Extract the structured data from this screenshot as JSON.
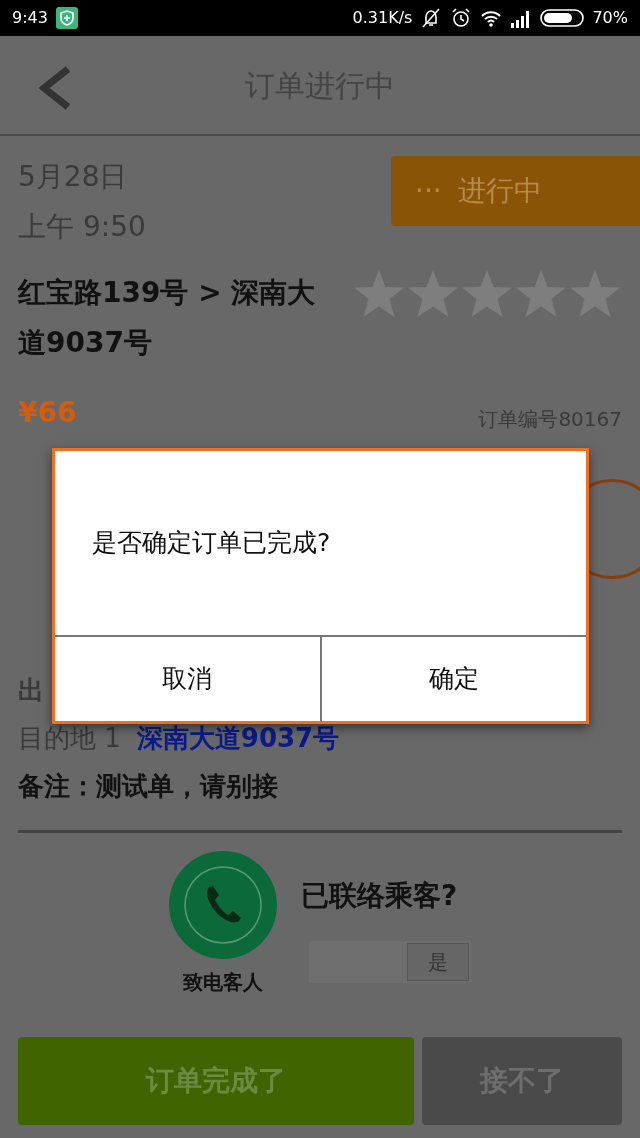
{
  "status_bar": {
    "time": "9:43",
    "speed": "0.31K/s",
    "battery": "70%"
  },
  "header": {
    "title": "订单进行中"
  },
  "order": {
    "date": "5月28日",
    "time": "上午 9:50",
    "status": "进行中",
    "status_dots": "···",
    "route": "红宝路139号 > 深南大道9037号",
    "stars": 0,
    "price": "¥66",
    "order_no": "订单编号80167"
  },
  "details": [
    {
      "kind": "partial",
      "label": "出"
    },
    {
      "kind": "address",
      "label": "目的地 1",
      "value": "深南大道9037号"
    },
    {
      "kind": "note",
      "label": "备注：测试单，请别接"
    }
  ],
  "contact": {
    "call_label": "致电客人",
    "question": "已联络乘客?",
    "toggle": {
      "label": "是",
      "on": true
    }
  },
  "actions": [
    {
      "kind": "primary",
      "label": "订单完成了"
    },
    {
      "kind": "secondary",
      "label": "接不了"
    }
  ],
  "dialog": {
    "message": "是否确定订单已完成?",
    "buttons": [
      "取消",
      "确定"
    ]
  }
}
